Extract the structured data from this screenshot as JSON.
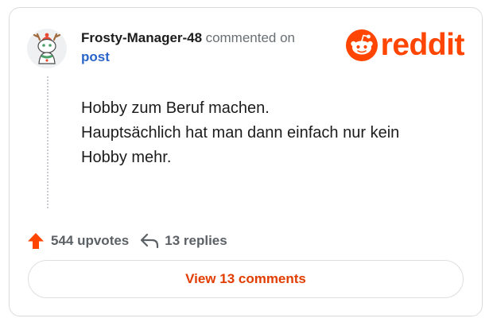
{
  "comment": {
    "username": "Frosty-Manager-48",
    "action_text": "commented on",
    "post_link": "post",
    "avatar_icon": "snoo-deer-avatar-icon",
    "body_lines": [
      "Hobby zum Beruf machen.",
      "Hauptsächlich hat man dann einfach nur kein",
      "Hobby mehr."
    ]
  },
  "brand": {
    "logo_icon": "reddit-snoo-icon",
    "wordmark": "reddit",
    "color": "#ff4500"
  },
  "stats": {
    "upvotes_label": "544 upvotes",
    "upvote_icon": "upvote-arrow-icon",
    "upvote_color": "#ff4500",
    "replies_label": "13 replies",
    "replies_icon": "reply-arrow-icon"
  },
  "actions": {
    "view_comments_label": "View 13 comments",
    "accent_color": "#e23d00"
  }
}
